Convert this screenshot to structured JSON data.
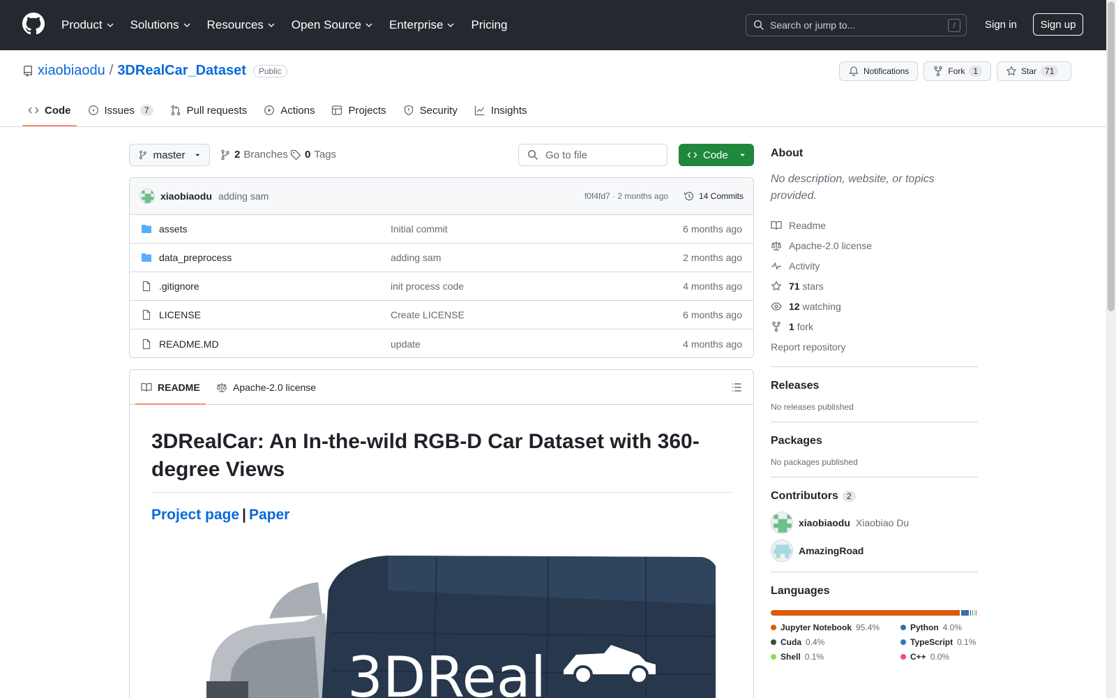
{
  "header": {
    "nav": [
      {
        "label": "Product",
        "dropdown": true
      },
      {
        "label": "Solutions",
        "dropdown": true
      },
      {
        "label": "Resources",
        "dropdown": true
      },
      {
        "label": "Open Source",
        "dropdown": true
      },
      {
        "label": "Enterprise",
        "dropdown": true
      },
      {
        "label": "Pricing",
        "dropdown": false
      }
    ],
    "search_placeholder": "Search or jump to...",
    "search_shortcut": "/",
    "sign_in": "Sign in",
    "sign_up": "Sign up"
  },
  "repo": {
    "owner": "xiaobiaodu",
    "separator": "/",
    "name": "3DRealCar_Dataset",
    "visibility": "Public",
    "notifications_label": "Notifications",
    "fork_label": "Fork",
    "fork_count": "1",
    "star_label": "Star",
    "star_count": "71"
  },
  "tabs": [
    {
      "label": "Code",
      "icon": "code-icon",
      "active": true
    },
    {
      "label": "Issues",
      "icon": "issue-icon",
      "count": "7"
    },
    {
      "label": "Pull requests",
      "icon": "pull-request-icon"
    },
    {
      "label": "Actions",
      "icon": "play-icon"
    },
    {
      "label": "Projects",
      "icon": "table-icon"
    },
    {
      "label": "Security",
      "icon": "shield-icon"
    },
    {
      "label": "Insights",
      "icon": "graph-icon"
    }
  ],
  "filenav": {
    "branch": "master",
    "branches_count": "2",
    "branches_label": "Branches",
    "tags_count": "0",
    "tags_label": "Tags",
    "goto_placeholder": "Go to file",
    "code_button": "Code"
  },
  "latest_commit": {
    "author": "xiaobiaodu",
    "message": "adding sam",
    "hash_time": "f0f4fd7 · 2 months ago",
    "commits": "14 Commits"
  },
  "files": [
    {
      "name": "assets",
      "type": "folder",
      "message": "Initial commit",
      "date": "6 months ago"
    },
    {
      "name": "data_preprocess",
      "type": "folder",
      "message": "adding sam",
      "date": "2 months ago"
    },
    {
      "name": ".gitignore",
      "type": "file",
      "message": "init process code",
      "date": "4 months ago"
    },
    {
      "name": "LICENSE",
      "type": "file",
      "message": "Create LICENSE",
      "date": "6 months ago"
    },
    {
      "name": "README.MD",
      "type": "file",
      "message": "update",
      "date": "4 months ago"
    }
  ],
  "readme": {
    "tab_readme": "README",
    "tab_license": "Apache-2.0 license",
    "title": "3DRealCar: An In-the-wild RGB-D Car Dataset with 360-degree Views",
    "link_project": "Project page",
    "link_separator": "|",
    "link_paper": "Paper",
    "hero_logo_text": "3DReal"
  },
  "sidebar": {
    "about_heading": "About",
    "about_desc": "No description, website, or topics provided.",
    "items": [
      {
        "icon": "book-icon",
        "label": "Readme"
      },
      {
        "icon": "law-icon",
        "label": "Apache-2.0 license"
      },
      {
        "icon": "pulse-icon",
        "label": "Activity"
      },
      {
        "icon": "star-icon",
        "count": "71",
        "label": "stars"
      },
      {
        "icon": "eye-icon",
        "count": "12",
        "label": "watching"
      },
      {
        "icon": "fork-icon",
        "count": "1",
        "label": "fork"
      }
    ],
    "report": "Report repository",
    "releases_heading": "Releases",
    "releases_empty": "No releases published",
    "packages_heading": "Packages",
    "packages_empty": "No packages published",
    "contributors_heading": "Contributors",
    "contributors_count": "2",
    "contributors": [
      {
        "login": "xiaobiaodu",
        "name": "Xiaobiao Du"
      },
      {
        "login": "AmazingRoad",
        "name": ""
      }
    ],
    "languages_heading": "Languages",
    "languages": [
      {
        "name": "Jupyter Notebook",
        "pct": "95.4%",
        "value": 95.4,
        "color": "#DA5B0B"
      },
      {
        "name": "Python",
        "pct": "4.0%",
        "value": 4.0,
        "color": "#3572A5"
      },
      {
        "name": "Cuda",
        "pct": "0.4%",
        "value": 0.4,
        "color": "#3A4E3A"
      },
      {
        "name": "TypeScript",
        "pct": "0.1%",
        "value": 0.1,
        "color": "#3178c6"
      },
      {
        "name": "Shell",
        "pct": "0.1%",
        "value": 0.1,
        "color": "#89e051"
      },
      {
        "name": "C++",
        "pct": "0.0%",
        "value": 0.0,
        "color": "#f34b7d"
      }
    ]
  }
}
